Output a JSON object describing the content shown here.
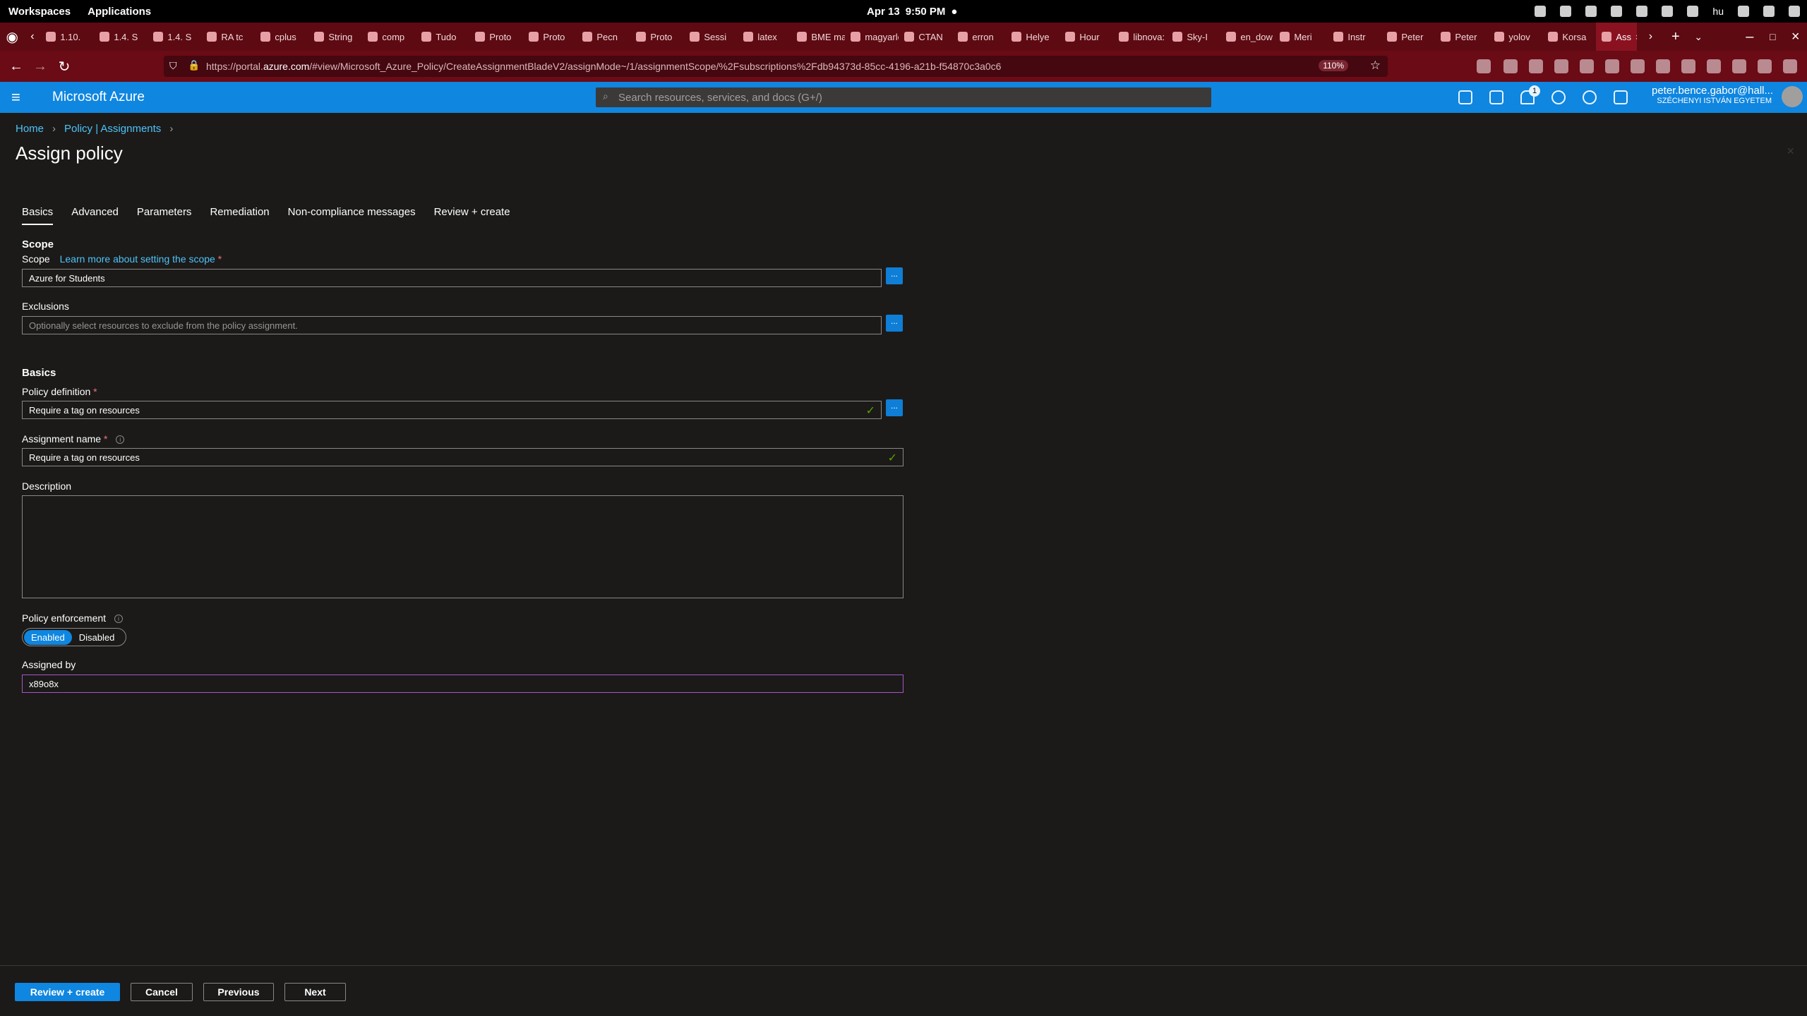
{
  "os": {
    "workspaces": "Workspaces",
    "applications": "Applications",
    "date": "Apr 13",
    "time": "9:50 PM",
    "lang": "hu"
  },
  "browser": {
    "tabs": [
      "1.10.",
      "1.4. S",
      "1.4. S",
      "RA tc",
      "cplus",
      "String",
      "comp",
      "Tudo",
      "Proto",
      "Proto",
      "Pecn",
      "Proto",
      "Sessi",
      "latex",
      "BME mat",
      "magyarlc",
      "CTAN",
      "erron",
      "Helye",
      "Hour",
      "libnova:",
      "Sky-I",
      "en_dow",
      "Meri",
      "Instr",
      "Peter",
      "Peter",
      "yolov",
      "Korsa",
      "Ass"
    ],
    "url_prefix": "https://portal.",
    "url_domain": "azure.com",
    "url_rest": "/#view/Microsoft_Azure_Policy/CreateAssignmentBladeV2/assignMode~/1/assignmentScope/%2Fsubscriptions%2Fdb94373d-85cc-4196-a21b-f54870c3a0c6",
    "zoom": "110%"
  },
  "azure": {
    "brand": "Microsoft Azure",
    "search_placeholder": "Search resources, services, and docs (G+/)",
    "notification_count": "1",
    "user_name": "peter.bence.gabor@hall...",
    "user_org": "SZÉCHENYI ISTVÁN EGYETEM"
  },
  "page": {
    "breadcrumb": [
      "Home",
      "Policy | Assignments"
    ],
    "title": "Assign policy",
    "tabs": [
      "Basics",
      "Advanced",
      "Parameters",
      "Remediation",
      "Non-compliance messages",
      "Review + create"
    ],
    "scope_section": "Scope",
    "scope_label": "Scope",
    "scope_link": "Learn more about setting the scope",
    "scope_value": "Azure for Students",
    "exclusions_label": "Exclusions",
    "exclusions_placeholder": "Optionally select resources to exclude from the policy assignment.",
    "basics_section": "Basics",
    "policy_def_label": "Policy definition",
    "policy_def_value": "Require a tag on resources",
    "assignment_name_label": "Assignment name",
    "assignment_name_value": "Require a tag on resources",
    "description_label": "Description",
    "enforcement_label": "Policy enforcement",
    "enforcement_enabled": "Enabled",
    "enforcement_disabled": "Disabled",
    "assigned_by_label": "Assigned by",
    "assigned_by_value": "x89o8x",
    "required_marker": "*",
    "ellipsis": "...",
    "check": "✓"
  },
  "footer": {
    "review": "Review + create",
    "cancel": "Cancel",
    "previous": "Previous",
    "next": "Next"
  }
}
